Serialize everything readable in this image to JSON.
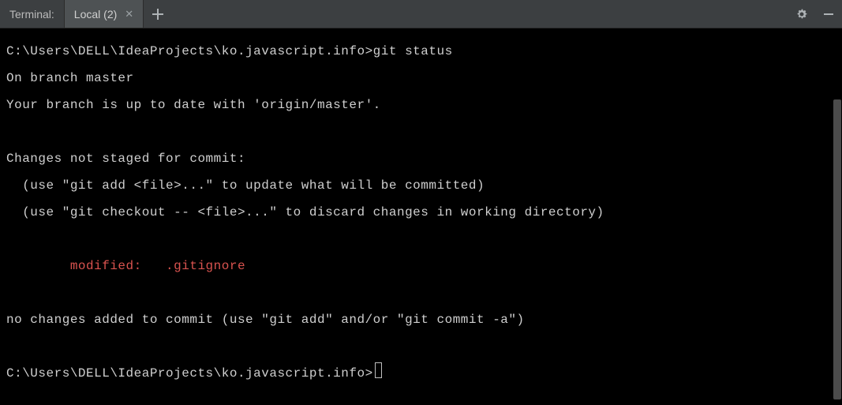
{
  "header": {
    "title": "Terminal:",
    "tab_label": "Local (2)"
  },
  "terminal": {
    "prompt": "C:\\Users\\DELL\\IdeaProjects\\ko.javascript.info>",
    "command": "git status",
    "lines": {
      "branch": "On branch master",
      "uptodate": "Your branch is up to date with 'origin/master'.",
      "not_staged": "Changes not staged for commit:",
      "hint_add": "  (use \"git add <file>...\" to update what will be committed)",
      "hint_checkout": "  (use \"git checkout -- <file>...\" to discard changes in working directory)",
      "modified": "        modified:   .gitignore",
      "no_changes": "no changes added to commit (use \"git add\" and/or \"git commit -a\")"
    }
  }
}
